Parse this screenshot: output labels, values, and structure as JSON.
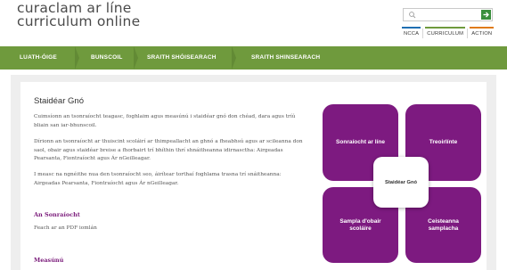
{
  "logo": {
    "line1": "curaclam ar líne",
    "line2": "curriculum online"
  },
  "search": {
    "placeholder": ""
  },
  "top_links": [
    {
      "label": "NCCA",
      "color": "#1f6fb2"
    },
    {
      "label": "CURRICULUM",
      "color": "#6f9a3d"
    },
    {
      "label": "ACTION",
      "color": "#e07b1a"
    }
  ],
  "nav": {
    "items": [
      {
        "label": "LUATH-ÓIGE"
      },
      {
        "label": "BUNSCOIL"
      },
      {
        "label": "SRAITH SHÓISEARACH"
      },
      {
        "label": "SRAITH SHINSEARACH"
      }
    ]
  },
  "main": {
    "title": "Staidéar Gnó",
    "paragraphs": [
      "Cuimsíonn an tsonraíocht teagasc, foghlaim agus measúnú i staidéar gnó don chéad, dara agus tríú bliain san iar-bhunscoil.",
      "Dírionn an tsonraíocht ar thuiscint scoláirí ar thimpeallacht an ghnó a fheabhsú agus ar scileanna don saol, obair agus staidéar breise a fhorbairt trí bhíthin thrí shnáitheanna idirnasctha: Airgeadas Pearsanta, Fiontraíocht agus Ár nGeilleagar.",
      "I measc na ngnéithe nua den tsonraíocht seo, áirítear torthaí foghlama trasna trí snáitheanna: Airgeadas Pearsanta, Fiontraíocht agus Ár nGeilleagar."
    ],
    "spec_heading": "An Sonraíocht",
    "spec_link": "Feach ar an PDF iomlán",
    "assessment_heading": "Measúnú"
  },
  "tiles": {
    "top_left": "Sonraíocht ar líne",
    "top_right": "Treoirlínte",
    "center": "Staidéar Gnó",
    "bottom_left_line1": "Sampla d'obair",
    "bottom_left_line2": "scoláire",
    "bottom_right_line1": "Ceisteanna",
    "bottom_right_line2": "samplacha"
  },
  "colors": {
    "nav_green": "#6f9a3d",
    "tile_purple": "#7d1a80",
    "heading_purple": "#7a1a7a"
  }
}
